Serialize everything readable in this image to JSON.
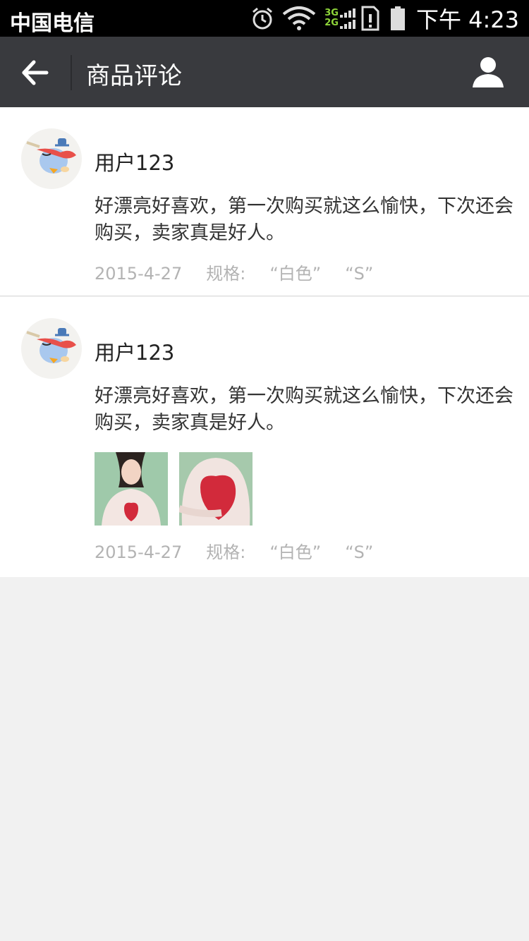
{
  "status_bar": {
    "carrier": "中国电信",
    "network_top": "3G",
    "network_bottom": "2G",
    "time": "下午 4:23",
    "icons": [
      "alarm-icon",
      "wifi-icon",
      "signal-icon",
      "sim-icon",
      "battery-icon"
    ]
  },
  "nav": {
    "title": "商品评论",
    "back_icon": "back-arrow-icon",
    "profile_icon": "user-icon",
    "background": "#393a3e"
  },
  "reviews": [
    {
      "username": "用户123",
      "comment": "好漂亮好喜欢，第一次购买就这么愉快，下次还会购买，卖家真是好人。",
      "date": "2015-4-27",
      "spec_label": "规格:",
      "spec_color": "“白色”",
      "spec_size": "“S”"
    },
    {
      "username": "用户123",
      "comment": "好漂亮好喜欢，第一次购买就这么愉快，下次还会购买，卖家真是好人。",
      "date": "2015-4-27",
      "spec_label": "规格:",
      "spec_color": "“白色”",
      "spec_size": "“S”"
    }
  ]
}
